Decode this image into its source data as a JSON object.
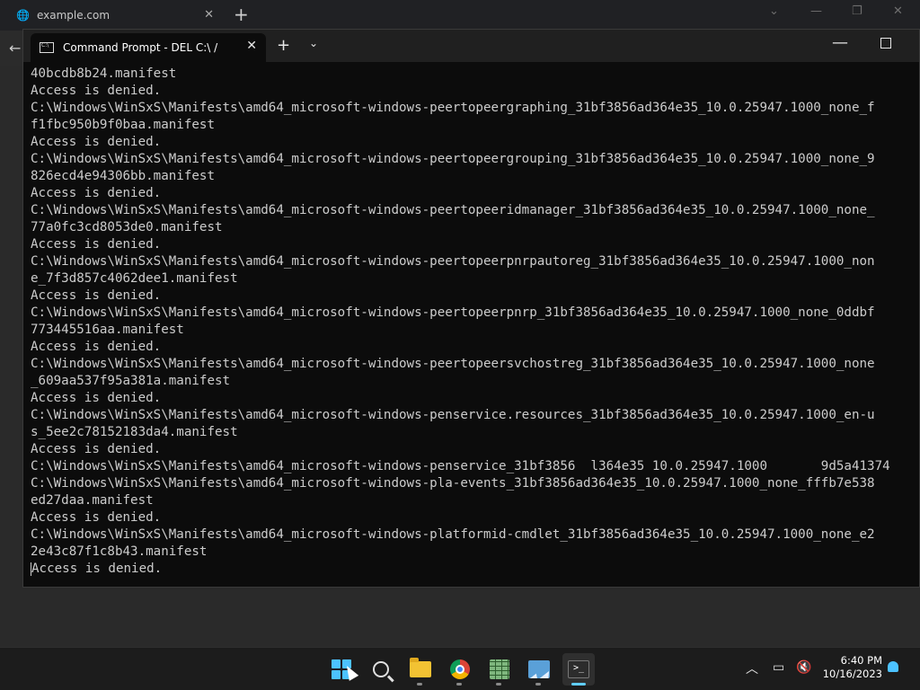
{
  "browser": {
    "tab_title": "example.com",
    "tab_close": "✕",
    "new_tab": "+"
  },
  "terminal": {
    "tab_title": "Command Prompt - DEL  C:\\ /",
    "tab_close": "✕",
    "new_tab": "+",
    "dropdown": "⌄",
    "minimize": "—",
    "lines": [
      "40bcdb8b24.manifest",
      "Access is denied.",
      "C:\\Windows\\WinSxS\\Manifests\\amd64_microsoft-windows-peertopeergraphing_31bf3856ad364e35_10.0.25947.1000_none_f",
      "f1fbc950b9f0baa.manifest",
      "Access is denied.",
      "C:\\Windows\\WinSxS\\Manifests\\amd64_microsoft-windows-peertopeergrouping_31bf3856ad364e35_10.0.25947.1000_none_9",
      "826ecd4e94306bb.manifest",
      "Access is denied.",
      "C:\\Windows\\WinSxS\\Manifests\\amd64_microsoft-windows-peertopeeridmanager_31bf3856ad364e35_10.0.25947.1000_none_",
      "77a0fc3cd8053de0.manifest",
      "Access is denied.",
      "C:\\Windows\\WinSxS\\Manifests\\amd64_microsoft-windows-peertopeerpnrpautoreg_31bf3856ad364e35_10.0.25947.1000_non",
      "e_7f3d857c4062dee1.manifest",
      "Access is denied.",
      "C:\\Windows\\WinSxS\\Manifests\\amd64_microsoft-windows-peertopeerpnrp_31bf3856ad364e35_10.0.25947.1000_none_0ddbf",
      "773445516aa.manifest",
      "Access is denied.",
      "C:\\Windows\\WinSxS\\Manifests\\amd64_microsoft-windows-peertopeersvchostreg_31bf3856ad364e35_10.0.25947.1000_none",
      "_609aa537f95a381a.manifest",
      "Access is denied.",
      "C:\\Windows\\WinSxS\\Manifests\\amd64_microsoft-windows-penservice.resources_31bf3856ad364e35_10.0.25947.1000_en-u",
      "s_5ee2c78152183da4.manifest",
      "Access is denied.",
      "C:\\Windows\\WinSxS\\Manifests\\amd64_microsoft-windows-penservice_31bf3856  l364e35 10.0.25947.1000       9d5a41374",
      "C:\\Windows\\WinSxS\\Manifests\\amd64_microsoft-windows-pla-events_31bf3856ad364e35_10.0.25947.1000_none_fffb7e538",
      "ed27daa.manifest",
      "Access is denied.",
      "C:\\Windows\\WinSxS\\Manifests\\amd64_microsoft-windows-platformid-cmdlet_31bf3856ad364e35_10.0.25947.1000_none_e2",
      "2e43c87f1c8b43.manifest",
      "Access is denied."
    ]
  },
  "taskbar": {
    "apps": [
      {
        "name": "start",
        "icon": "windows-start-icon"
      },
      {
        "name": "search",
        "icon": "search-icon"
      },
      {
        "name": "file-explorer",
        "icon": "folder-icon"
      },
      {
        "name": "chrome",
        "icon": "chrome-icon"
      },
      {
        "name": "spreadsheet",
        "icon": "spreadsheet-icon"
      },
      {
        "name": "photos",
        "icon": "photos-icon"
      },
      {
        "name": "terminal",
        "icon": "terminal-icon"
      }
    ],
    "time": "6:40 PM",
    "date": "10/16/2023",
    "accent_color": "#4cc2ff"
  }
}
